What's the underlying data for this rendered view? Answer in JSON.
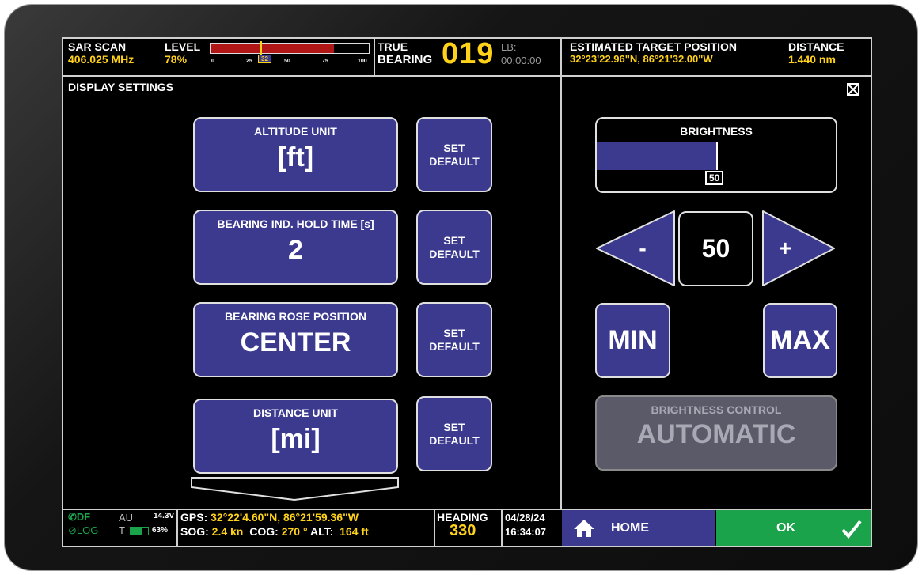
{
  "header": {
    "scan_label": "SAR SCAN",
    "frequency": "406.025 MHz",
    "level_label": "LEVEL",
    "level_value": "78%",
    "level_ticks": [
      "0",
      "25",
      "32",
      "50",
      "75",
      "100"
    ],
    "level_fill_percent": 78,
    "level_marker_percent": 32,
    "true_label": "TRUE",
    "bearing_label": "BEARING",
    "bearing_value": "019",
    "lb_label": "LB:",
    "lb_time": "00:00:00",
    "est_label": "ESTIMATED TARGET POSITION",
    "est_coords": "32°23'22.96\"N,  86°21'32.00\"W",
    "distance_label": "DISTANCE",
    "distance_value": "1.440 nm"
  },
  "panel": {
    "title": "DISPLAY SETTINGS",
    "settings": [
      {
        "caption": "ALTITUDE UNIT",
        "value": "[ft]"
      },
      {
        "caption": "BEARING IND. HOLD TIME [s]",
        "value": "2"
      },
      {
        "caption": "BEARING ROSE POSITION",
        "value": "CENTER"
      },
      {
        "caption": "DISTANCE UNIT",
        "value": "[mi]"
      }
    ],
    "set_default_line1": "SET",
    "set_default_line2": "DEFAULT"
  },
  "brightness": {
    "label": "BRIGHTNESS",
    "value": "50",
    "fill_percent": 50,
    "minus_label": "-",
    "plus_label": "+",
    "min_label": "MIN",
    "max_label": "MAX",
    "control_caption": "BRIGHTNESS CONTROL",
    "control_value": "AUTOMATIC"
  },
  "footer": {
    "df_label": "DF",
    "log_label": "LOG",
    "au_label": "AU",
    "voltage": "14.3V",
    "t_label": "T",
    "battery": "63%",
    "gps_label": "GPS:",
    "gps_coords": "32°22'4.60\"N,  86°21'59.36\"W",
    "sog_label": "SOG:",
    "sog_value": "2.4 kn",
    "cog_label": "COG:",
    "cog_value": "270 °",
    "alt_label": "ALT:",
    "alt_value": "164 ft",
    "heading_label": "HEADING",
    "heading_value": "330",
    "date": "04/28/24",
    "time": "16:34:07",
    "home_label": "HOME",
    "ok_label": "OK"
  },
  "colors": {
    "button_blue": "#3b3a8f",
    "accent_yellow": "#ffd21a",
    "ok_green": "#1aa34a",
    "level_red": "#b01616",
    "disabled_gray": "#5a5a68"
  }
}
